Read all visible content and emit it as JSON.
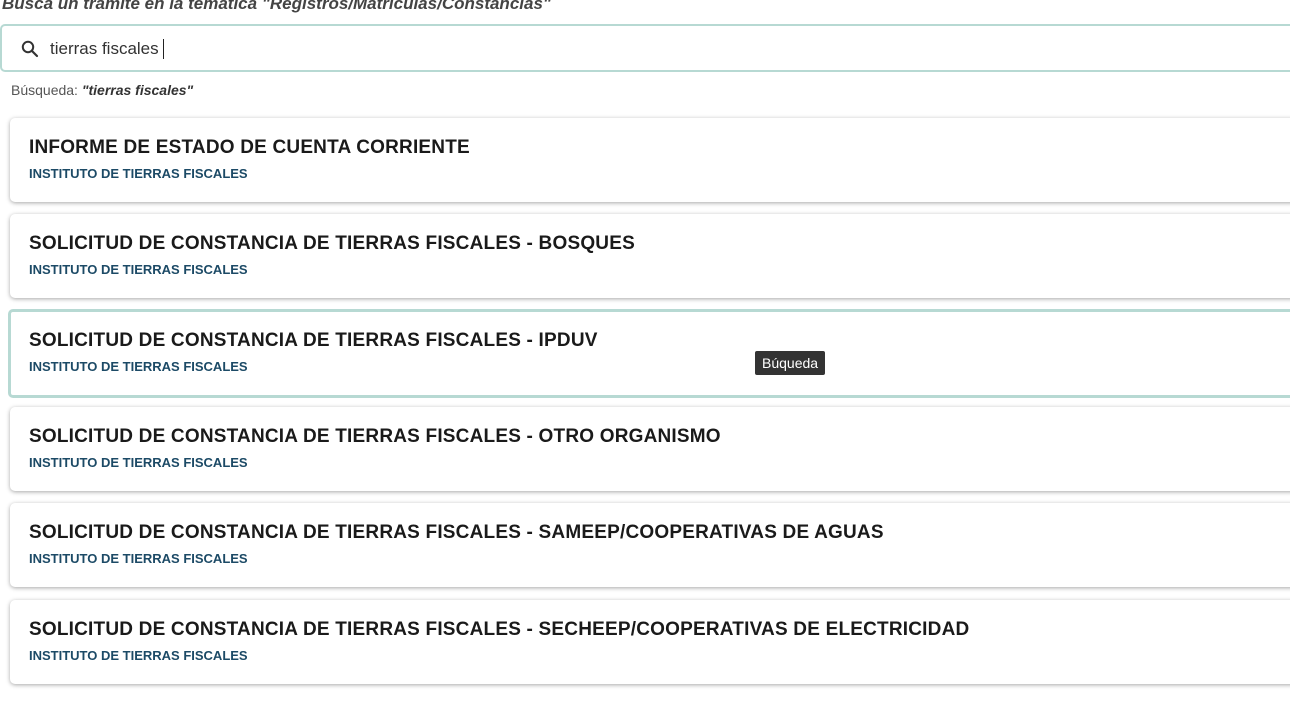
{
  "heading": "Buscá un trámite en la temática \"Registros/Matrículas/Constancias\"",
  "search": {
    "value": "tierras fiscales",
    "icon": "search-icon"
  },
  "query": {
    "label": "Búsqueda:",
    "value": "\"tierras fiscales\""
  },
  "results": [
    {
      "title": "INFORME DE ESTADO DE CUENTA CORRIENTE",
      "agency": "INSTITUTO DE TIERRAS FISCALES"
    },
    {
      "title": "SOLICITUD DE CONSTANCIA DE TIERRAS FISCALES - BOSQUES",
      "agency": "INSTITUTO DE TIERRAS FISCALES"
    },
    {
      "title": "SOLICITUD DE CONSTANCIA DE TIERRAS FISCALES - IPDUV",
      "agency": "INSTITUTO DE TIERRAS FISCALES"
    },
    {
      "title": "SOLICITUD DE CONSTANCIA DE TIERRAS FISCALES - OTRO ORGANISMO",
      "agency": "INSTITUTO DE TIERRAS FISCALES"
    },
    {
      "title": "SOLICITUD DE CONSTANCIA DE TIERRAS FISCALES - SAMEEP/COOPERATIVAS DE AGUAS",
      "agency": "INSTITUTO DE TIERRAS FISCALES"
    },
    {
      "title": "SOLICITUD DE CONSTANCIA DE TIERRAS FISCALES - SECHEEP/COOPERATIVAS DE ELECTRICIDAD",
      "agency": "INSTITUTO DE TIERRAS FISCALES"
    }
  ],
  "tooltip": "Búqueda",
  "colors": {
    "focus_border": "#b7d9d3",
    "agency_text": "#1c4a66"
  }
}
